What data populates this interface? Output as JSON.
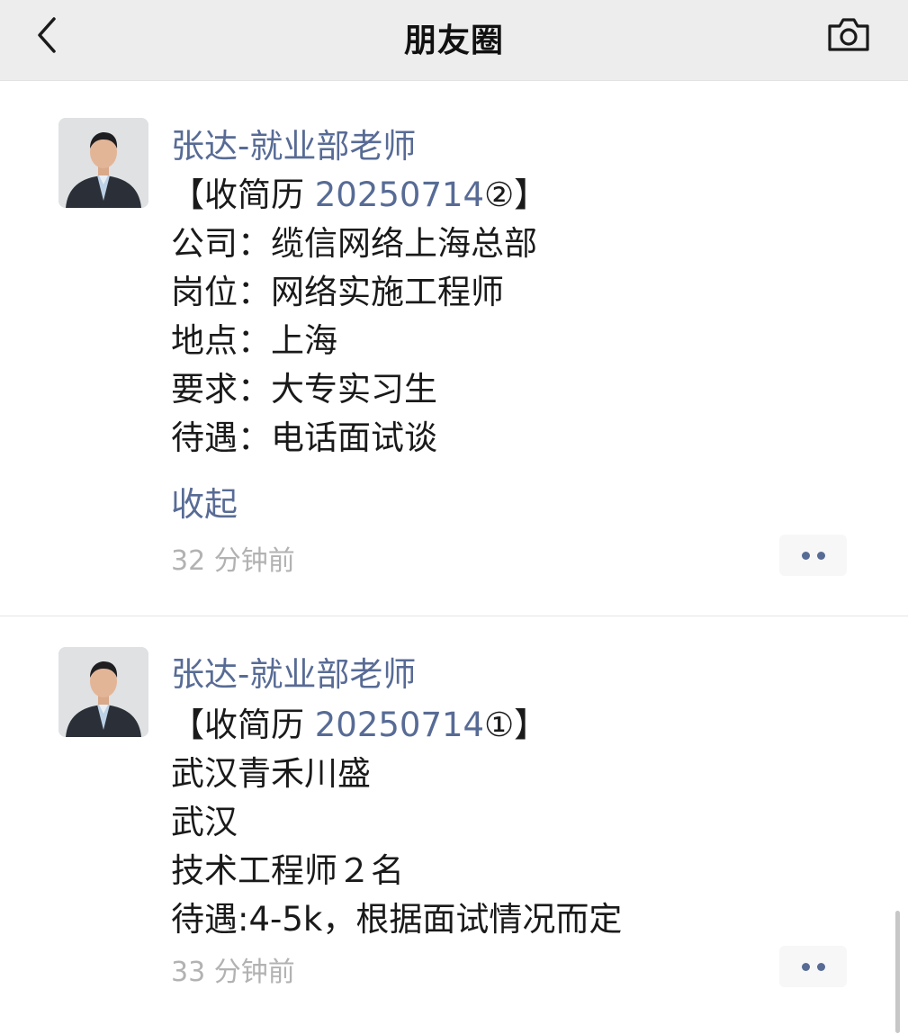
{
  "header": {
    "title": "朋友圈",
    "back_icon": "chevron-left-icon",
    "camera_icon": "camera-icon"
  },
  "posts": [
    {
      "author": "张达-就业部老师",
      "lines": [
        {
          "prefix": "【收简历 ",
          "num": "20250714",
          "suffix": "②】"
        },
        {
          "text": "公司：缆信网络上海总部"
        },
        {
          "text": "岗位：网络实施工程师"
        },
        {
          "text": "地点：上海"
        },
        {
          "text": "要求：大专实习生"
        },
        {
          "text": "待遇：电话面试谈"
        }
      ],
      "collapse_label": "收起",
      "time": "32 分钟前"
    },
    {
      "author": "张达-就业部老师",
      "lines": [
        {
          "prefix": "【收简历 ",
          "num": "20250714",
          "suffix": "①】"
        },
        {
          "text": "武汉青禾川盛"
        },
        {
          "text": "武汉"
        },
        {
          "text": "技术工程师２名"
        },
        {
          "text": "待遇:4-5k，根据面试情况而定"
        }
      ],
      "time": "33 分钟前"
    }
  ],
  "colors": {
    "link": "#576b95",
    "nav_bg": "#ededed",
    "time": "#b2b2b2"
  }
}
